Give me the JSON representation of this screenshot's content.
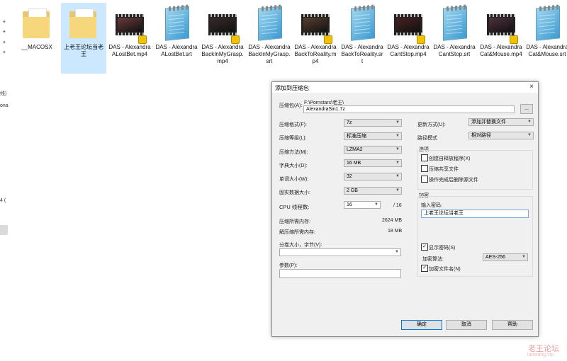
{
  "nav": {
    "text1": "线)",
    "text2": "ona",
    "text3": "4 ("
  },
  "files": [
    {
      "type": "folder",
      "label": "__MACOSX"
    },
    {
      "type": "folder",
      "label": "上老王论坛当老王",
      "selected": true
    },
    {
      "type": "video",
      "label": "DAS - Alexandra ALostBet.mp4"
    },
    {
      "type": "text",
      "label": "DAS - Alexandra ALostBet.srt"
    },
    {
      "type": "video",
      "label": "DAS - Alexandra BackInMyGrasp.mp4"
    },
    {
      "type": "text",
      "label": "DAS - Alexandra BackInMyGrasp.srt"
    },
    {
      "type": "video",
      "label": "DAS - Alexandra BackToReality.mp4"
    },
    {
      "type": "text",
      "label": "DAS - Alexandra BackToReality.srt"
    },
    {
      "type": "video",
      "label": "DAS - Alexandra CantStop.mp4"
    },
    {
      "type": "text",
      "label": "DAS - Alexandra CantStop.srt"
    },
    {
      "type": "video",
      "label": "DAS - Alexandra Cat&Mouse.mp4"
    },
    {
      "type": "text",
      "label": "DAS - Alexandra Cat&Mouse.srt"
    }
  ],
  "dialog": {
    "title": "添加到压缩包",
    "close": "×",
    "archive_label": "压缩包(A):",
    "archive_path": "F:\\Pornstars\\老王\\",
    "archive_name": "AlexandraSin1.7z",
    "browse": "...",
    "format_label": "压缩格式(F):",
    "format_value": "7z",
    "level_label": "压缩等级(L):",
    "level_value": "标准压缩",
    "method_label": "压缩方法(M):",
    "method_value": "LZMA2",
    "dict_label": "字典大小(D):",
    "dict_value": "16 MB",
    "word_label": "单词大小(W):",
    "word_value": "32",
    "solid_label": "固实数据大小:",
    "solid_value": "2 GB",
    "cpu_label": "CPU 线程数:",
    "cpu_value": "16",
    "cpu_total": "/ 16",
    "mem_comp_label": "压缩所需内存:",
    "mem_comp_value": "2624 MB",
    "mem_decomp_label": "解压缩所需内存:",
    "mem_decomp_value": "18 MB",
    "split_label": "分卷大小，字节(V):",
    "params_label": "参数(P):",
    "update_label": "更新方式(U):",
    "update_value": "添加并替换文件",
    "path_label": "路径模式",
    "path_value": "相对路径",
    "options_title": "选项",
    "opt_sfx": "创建自释放程序(X)",
    "opt_shared": "压缩共享文件",
    "opt_delete": "操作完成后删除源文件",
    "enc_title": "加密",
    "pwd_label": "输入密码:",
    "pwd_value": "上老王论坛当老王",
    "show_pwd": "显示密码(S)",
    "enc_method_label": "加密算法:",
    "enc_method_value": "AES-256",
    "enc_names": "加密文件名(N)",
    "ok": "确定",
    "cancel": "取消",
    "help": "帮助"
  },
  "watermark": {
    "line1": "老王论坛",
    "line2": "laowang.vip"
  }
}
